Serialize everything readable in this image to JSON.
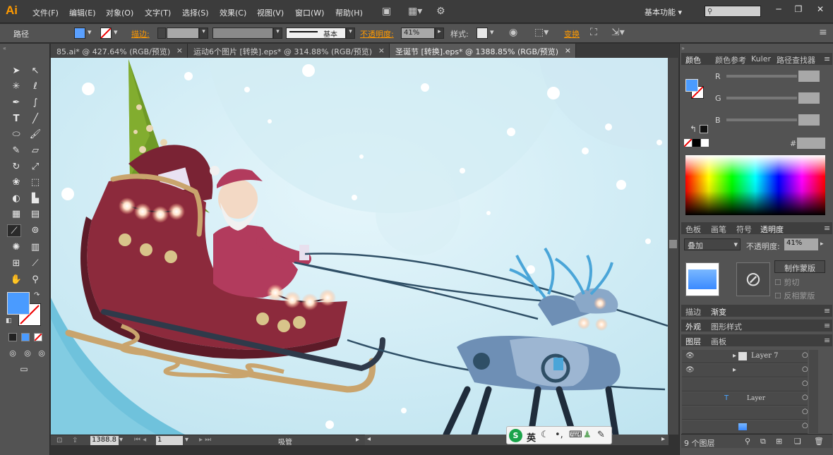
{
  "app": {
    "logo": "Ai",
    "workspace": "基本功能",
    "search_placeholder": ""
  },
  "menu": [
    "文件(F)",
    "编辑(E)",
    "对象(O)",
    "文字(T)",
    "选择(S)",
    "效果(C)",
    "视图(V)",
    "窗口(W)",
    "帮助(H)"
  ],
  "control": {
    "object_type": "路径",
    "stroke_label": "描边:",
    "stroke_profile": "基本",
    "opacity_label": "不透明度:",
    "opacity_value": "41%",
    "style_label": "样式:",
    "transform_label": "变换"
  },
  "tabs": [
    {
      "label": "85.ai* @ 427.64% (RGB/预览)",
      "close": "×"
    },
    {
      "label": "运动6个图片 [转换].eps* @ 314.88% (RGB/预览)",
      "close": "×"
    },
    {
      "label": "圣诞节 [转换].eps* @ 1388.85% (RGB/预览)",
      "close": "×"
    }
  ],
  "status": {
    "zoom": "1388.8",
    "artboard": "1",
    "tool_name": "吸管"
  },
  "panels": {
    "color": {
      "tabs": [
        "颜色",
        "颜色参考",
        "Kuler",
        "路径查找器"
      ],
      "channels": [
        "R",
        "G",
        "B"
      ],
      "hash": "#"
    },
    "transparency": {
      "tabs": [
        "色板",
        "画笔",
        "符号",
        "透明度"
      ],
      "blend_mode": "叠加",
      "opacity_label": "不透明度:",
      "opacity_value": "41%",
      "make_mask": "制作蒙版",
      "clip": "剪切",
      "invert": "反相蒙版"
    },
    "stroke": {
      "tabs": [
        "描边",
        "渐变"
      ]
    },
    "appearance": {
      "tabs": [
        "外观",
        "图形样式"
      ]
    },
    "layers": {
      "tabs": [
        "图层",
        "画板"
      ],
      "rows": [
        "Layer 7",
        "Layer"
      ],
      "footer": "9 个图层"
    }
  },
  "ime": {
    "label": "英"
  },
  "colors": {
    "sky": "#c9e9f3",
    "sled": "#8c2a3c",
    "santa": "#b23b5d",
    "reindeer": "#6e8fb5",
    "tree": "#6f9a26",
    "accent": "#ff9a00"
  }
}
